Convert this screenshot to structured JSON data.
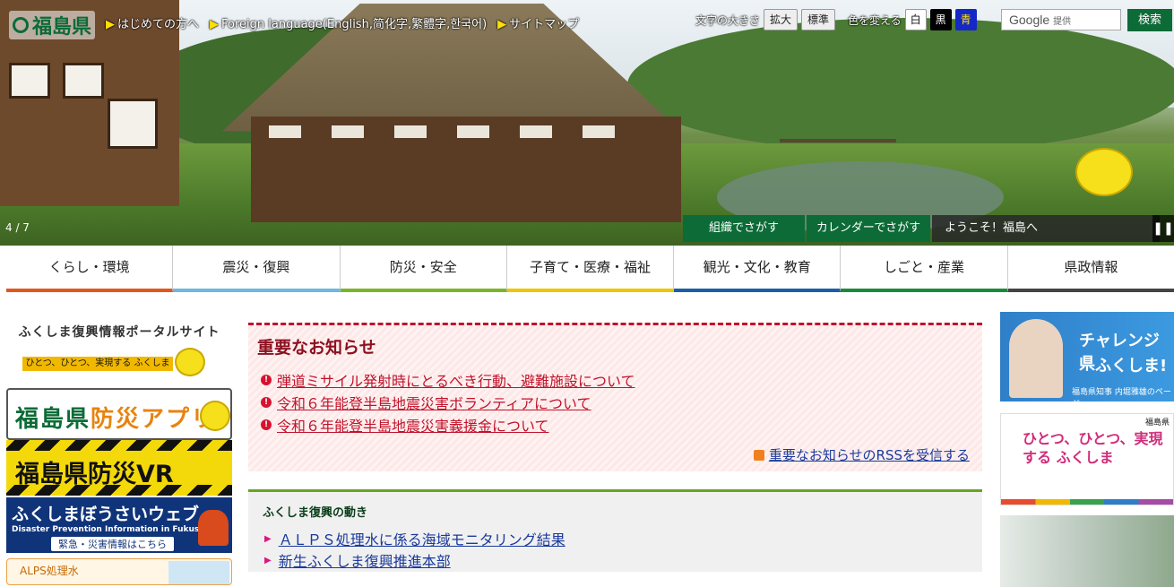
{
  "header": {
    "logo_text": "福島県",
    "links": [
      {
        "label": "はじめての方へ"
      },
      {
        "label": "Foreign language(English,简化字,繁體字,한국어)"
      },
      {
        "label": "サイトマップ"
      }
    ],
    "font_size_label": "文字の大きさ",
    "font_size_buttons": [
      "拡大",
      "標準"
    ],
    "color_label": "色を変える",
    "color_buttons": [
      {
        "label": "白",
        "bg": "#ffffff",
        "fg": "#111111"
      },
      {
        "label": "黒",
        "bg": "#000000",
        "fg": "#ffffff"
      },
      {
        "label": "青",
        "bg": "#1428c8",
        "fg": "#ffe000"
      }
    ],
    "search_provider": "Google",
    "search_provider_suffix": "提供",
    "search_button": "検索"
  },
  "hero": {
    "counter": "4 / 7",
    "tabs": [
      "組織でさがす",
      "カレンダーでさがす",
      "ようこそ！福島へ"
    ],
    "pause_icon": "pause-icon"
  },
  "global_nav": [
    {
      "label": "くらし・環境",
      "color": "#e0581e"
    },
    {
      "label": "震災・復興",
      "color": "#6fb6e0"
    },
    {
      "label": "防災・安全",
      "color": "#7ab52b"
    },
    {
      "label": "子育て・医療・福祉",
      "color": "#f1c400"
    },
    {
      "label": "観光・文化・教育",
      "color": "#1b5fa6"
    },
    {
      "label": "しごと・産業",
      "color": "#1c8a3c"
    },
    {
      "label": "県政情報",
      "color": "#444444"
    }
  ],
  "left_banners": {
    "portal_title": "ふくしま復興情報ポータルサイト",
    "portal_sub": "ひとつ、ひとつ、実現する ふくしま",
    "app_title_a": "福島県",
    "app_title_b": "防災アプリ",
    "vr_title": "福島県防災VR",
    "web_title": "ふくしまぼうさいウェブ",
    "web_en": "Disaster Prevention Information in Fukushima",
    "web_cta": "緊急・災害情報はこちら",
    "alps": "ALPS処理水"
  },
  "notice": {
    "title": "重要なお知らせ",
    "items": [
      "弾道ミサイル発射時にとるべき行動、避難施設について",
      "令和６年能登半島地震災害ボランティアについて",
      "令和６年能登半島地震災害義援金について"
    ],
    "rss": "重要なお知らせのRSSを受信する"
  },
  "fukko": {
    "title": "ふくしま復興の動き",
    "items": [
      "ＡＬＰＳ処理水に係る海域モニタリング結果",
      "新生ふくしま復興推進本部"
    ]
  },
  "right_banners": {
    "gov_t1": "チャレンジ県",
    "gov_t2": "ふくしま!",
    "gov_cap": "福島県知事 内堀雅雄のページ",
    "hitotsu": "ひとつ、ひとつ、実現する ふくしま",
    "hitotsu_pref": "福島県"
  }
}
